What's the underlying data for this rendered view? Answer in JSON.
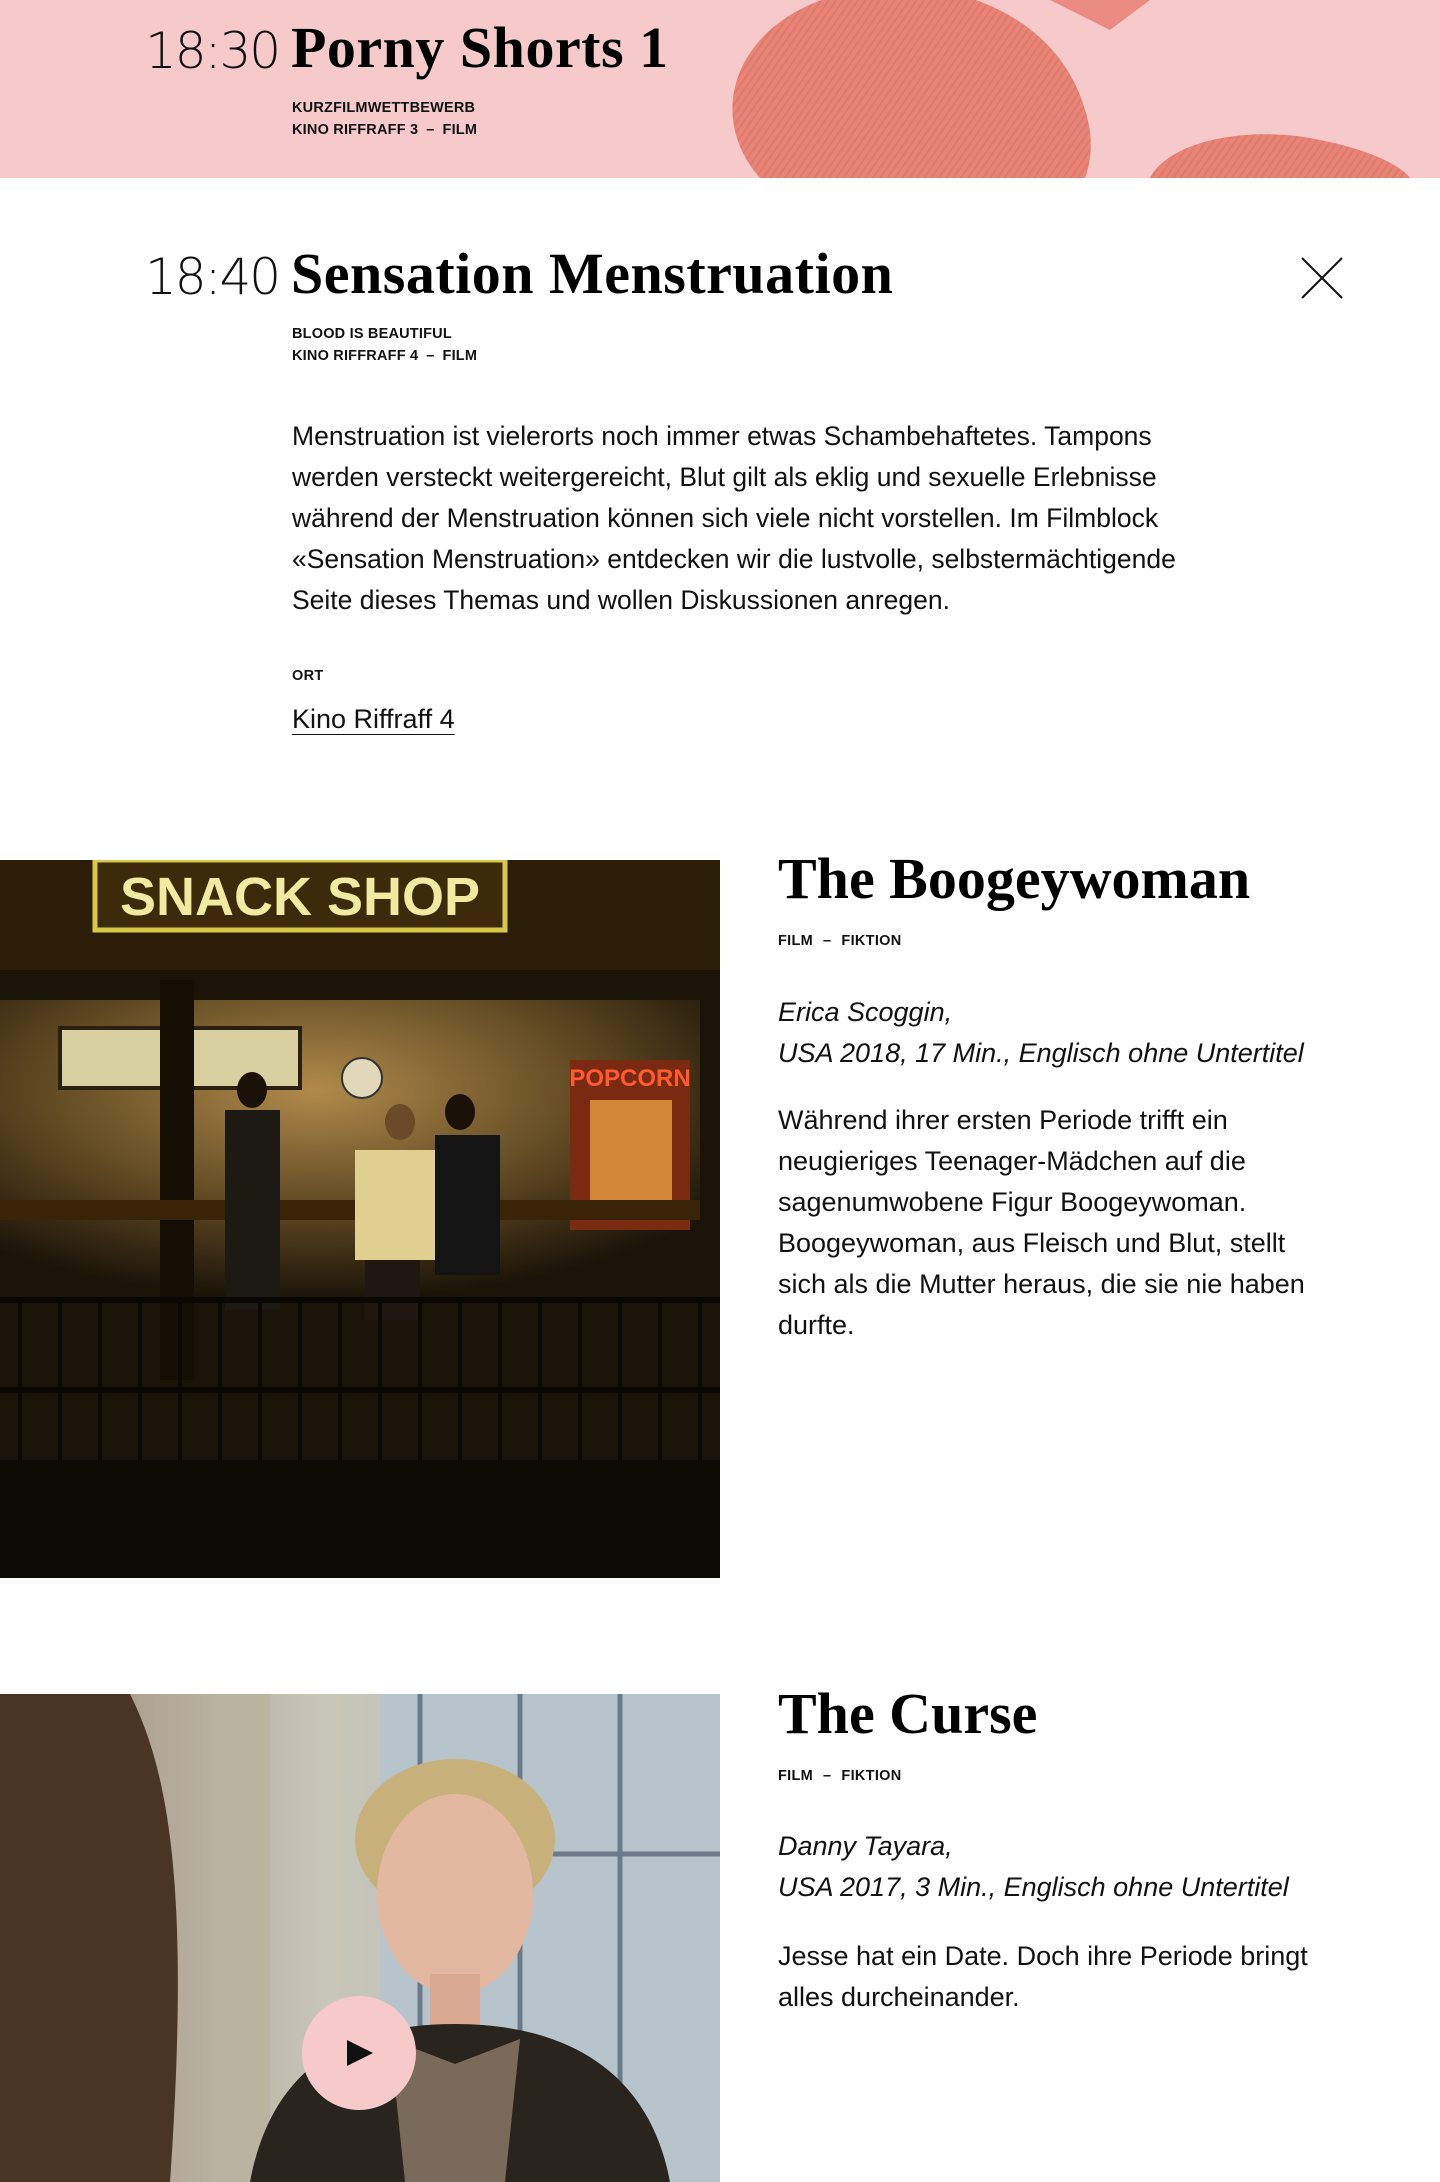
{
  "banner_event": {
    "time": "18:30",
    "title": "Porny Shorts 1",
    "category": "KURZFILMWETTBEWERB",
    "venue": "KINO RIFFRAFF 3",
    "type": "FILM"
  },
  "event": {
    "time": "18:40",
    "title": "Sensation Menstruation",
    "category": "BLOOD IS BEAUTIFUL",
    "venue": "KINO RIFFRAFF 4",
    "type": "FILM",
    "description": "Menstruation ist vielerorts noch immer etwas Schambehaftetes. Tampons werden versteckt weitergereicht, Blut gilt als eklig und sexuelle Erlebnisse während der Menstruation können sich viele nicht vorstellen. Im Filmblock «Sensation Menstruation» entdecken wir die lustvolle, selbstermächtigende Seite dieses Themas und wollen Diskussionen anregen.",
    "ort_label": "ORT",
    "ort_link": "Kino Riffraff 4"
  },
  "films": [
    {
      "title": "The Boogeywoman",
      "kind": "FILM",
      "genre": "FIKTION",
      "director": "Erica Scoggin,",
      "details": "USA 2018, 17 Min., Englisch ohne Untertitel",
      "description": "Während ihrer ersten Periode trifft ein neugieriges Teenager-Mädchen auf die sagenumwobene Figur Boogeywoman. Boogeywoman, aus Fleisch und Blut, stellt sich als die Mutter heraus, die sie nie haben durfte.",
      "image_sign": "SNACK SHOP",
      "image_popcorn": "POPCORN"
    },
    {
      "title": "The Curse",
      "kind": "FILM",
      "genre": "FIKTION",
      "director": "Danny Tayara,",
      "details": "USA 2017, 3 Min., Englisch ohne Untertitel",
      "description": "Jesse hat ein Date. Doch ihre Periode bringt alles durcheinander."
    }
  ],
  "colors": {
    "banner_pink": "#f6cacb",
    "banner_art": "#e88478",
    "play_button": "#f6cacb"
  },
  "icons": {
    "close": "close-icon",
    "play": "play-icon"
  }
}
